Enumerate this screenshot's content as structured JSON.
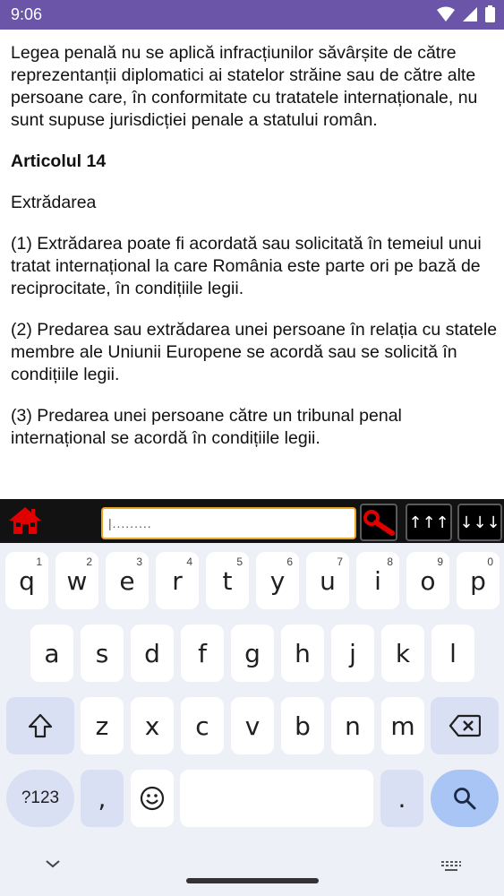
{
  "status_bar": {
    "time": "9:06"
  },
  "content": {
    "paragraphs": [
      {
        "text": "Legea penală nu se aplică infracțiunilor săvârșite de către reprezentanții diplomatici ai statelor străine sau de către alte persoane care, în conformitate cu tratatele internaționale, nu sunt supuse jurisdicției penale a statului român.",
        "bold": false
      },
      {
        "text": "Articolul 14",
        "bold": true
      },
      {
        "text": "Extrădarea",
        "bold": false
      },
      {
        "text": "(1) Extrădarea poate fi acordată sau solicitată în temeiul unui tratat internațional la care România este parte ori pe bază de reciprocitate, în condițiile legii.",
        "bold": false
      },
      {
        "text": "(2) Predarea sau extrădarea unei persoane în relația cu statele membre ale Uniunii Europene se acordă sau se solicită în condițiile legii.",
        "bold": false
      },
      {
        "text": "(3) Predarea unei persoane către un tribunal penal internațional se acordă în condițiile legii.",
        "bold": false
      }
    ]
  },
  "toolbar": {
    "search_value": "",
    "search_placeholder": "|.........",
    "up_label": "↑↑↑",
    "down_label": "↓↓↓",
    "accent_red": "#e00000",
    "input_border": "#e8a626"
  },
  "keyboard": {
    "row1": [
      {
        "key": "q",
        "hint": "1"
      },
      {
        "key": "w",
        "hint": "2"
      },
      {
        "key": "e",
        "hint": "3"
      },
      {
        "key": "r",
        "hint": "4"
      },
      {
        "key": "t",
        "hint": "5"
      },
      {
        "key": "y",
        "hint": "6"
      },
      {
        "key": "u",
        "hint": "7"
      },
      {
        "key": "i",
        "hint": "8"
      },
      {
        "key": "o",
        "hint": "9"
      },
      {
        "key": "p",
        "hint": "0"
      }
    ],
    "row2": [
      "a",
      "s",
      "d",
      "f",
      "g",
      "h",
      "j",
      "k",
      "l"
    ],
    "row3": [
      "z",
      "x",
      "c",
      "v",
      "b",
      "n",
      "m"
    ],
    "symbols_label": "?123",
    "comma": ",",
    "period": ".",
    "emoji_icon": "emoji-icon",
    "search_icon": "search-icon"
  }
}
